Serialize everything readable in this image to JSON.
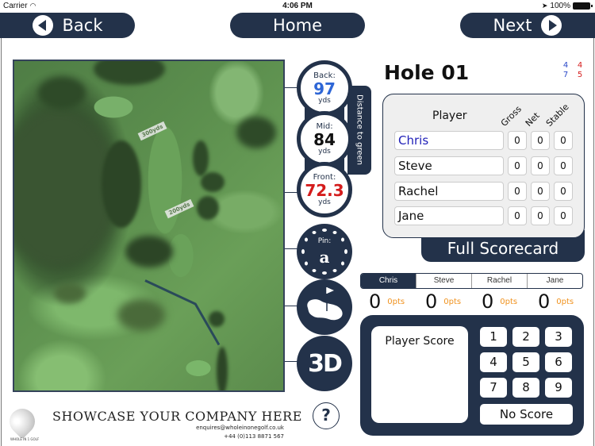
{
  "status_bar": {
    "carrier": "Carrier",
    "time": "4:06 PM",
    "battery": "100%"
  },
  "nav": {
    "back_label": "Back",
    "home_label": "Home",
    "next_label": "Next"
  },
  "map": {
    "yardage_markers": [
      "300yds",
      "200yds"
    ]
  },
  "distance": {
    "tab_label": "Distance to green",
    "back": {
      "label": "Back:",
      "value": "97",
      "unit": "yds",
      "color": "#2e66d6"
    },
    "mid": {
      "label": "Mid:",
      "value": "84",
      "unit": "yds",
      "color": "#111111"
    },
    "front": {
      "label": "Front:",
      "value": "72.3",
      "unit": "yds",
      "color": "#d41c1c"
    }
  },
  "pin": {
    "label": "Pin:",
    "value": "a"
  },
  "tools": {
    "threed_label": "3D"
  },
  "hole": {
    "title": "Hole 01",
    "stats": [
      {
        "value": "4",
        "color": "blue"
      },
      {
        "value": "4",
        "color": "red"
      },
      {
        "value": "7",
        "color": "blue"
      },
      {
        "value": "5",
        "color": "red"
      }
    ]
  },
  "scorecard": {
    "player_header": "Player",
    "columns": [
      "Gross",
      "Net",
      "Stable"
    ],
    "rows": [
      {
        "name": "Chris",
        "gross": "0",
        "net": "0",
        "stable": "0"
      },
      {
        "name": "Steve",
        "gross": "0",
        "net": "0",
        "stable": "0"
      },
      {
        "name": "Rachel",
        "gross": "0",
        "net": "0",
        "stable": "0"
      },
      {
        "name": "Jane",
        "gross": "0",
        "net": "0",
        "stable": "0"
      }
    ],
    "full_scorecard_label": "Full Scorecard"
  },
  "player_tabs": {
    "selected": "Chris",
    "tabs": [
      {
        "label": "Chris",
        "score": "0",
        "pts": "0pts"
      },
      {
        "label": "Steve",
        "score": "0",
        "pts": "0pts"
      },
      {
        "label": "Rachel",
        "score": "0",
        "pts": "0pts"
      },
      {
        "label": "Jane",
        "score": "0",
        "pts": "0pts"
      }
    ]
  },
  "keypad": {
    "player_score_label": "Player Score",
    "keys": [
      "1",
      "2",
      "3",
      "4",
      "5",
      "6",
      "7",
      "8",
      "9"
    ],
    "no_score_label": "No Score"
  },
  "footer": {
    "logo_text": "WHOLE IN 1 GOLF",
    "showcase": "SHOWCASE YOUR COMPANY HERE",
    "email": "enquires@wholeinonegolf.co.uk",
    "phone": "+44 (0)113 8871 567",
    "help_label": "?"
  }
}
